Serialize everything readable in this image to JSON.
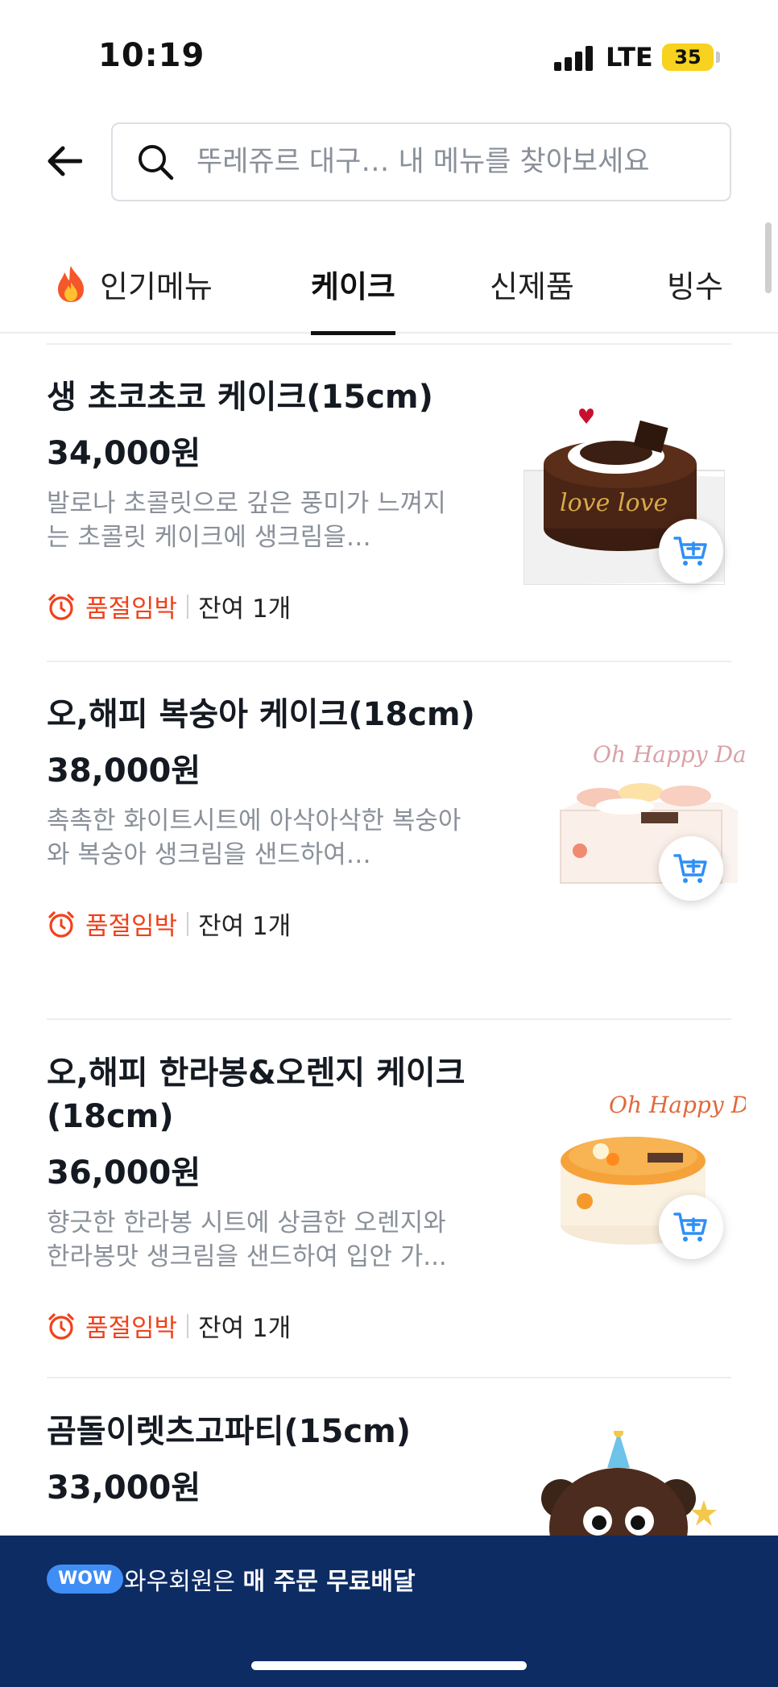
{
  "status_bar": {
    "time": "10:19",
    "network": "LTE",
    "battery": "35"
  },
  "search": {
    "placeholder": "뚜레쥬르 대구… 내 메뉴를 찾아보세요"
  },
  "tabs": [
    {
      "label": "인기메뉴",
      "active": false,
      "icon": "fire-icon"
    },
    {
      "label": "케이크",
      "active": true
    },
    {
      "label": "신제품",
      "active": false
    },
    {
      "label": "빙수",
      "active": false
    }
  ],
  "items": [
    {
      "name": "생 초코초코 케이크(15cm)",
      "price": "34,000원",
      "description": "발로나 초콜릿으로 깊은 풍미가 느껴지는 초콜릿 케이크에 생크림을…",
      "badge": "품절임박",
      "stock": "잔여 1개",
      "image_text": "love love"
    },
    {
      "name": "오,해피 복숭아 케이크(18cm)",
      "price": "38,000원",
      "description": "촉촉한 화이트시트에 아삭아삭한 복숭아와 복숭아 생크림을 샌드하여…",
      "badge": "품절임박",
      "stock": "잔여 1개",
      "image_text": "Oh Happy Day"
    },
    {
      "name": "오,해피 한라봉&오렌지 케이크(18cm)",
      "price": "36,000원",
      "description": "향긋한 한라봉 시트에 상큼한 오렌지와 한라봉맛 생크림을 샌드하여 입안 가...",
      "badge": "품절임박",
      "stock": "잔여 1개",
      "image_text": "Oh Happy Day"
    },
    {
      "name": "곰돌이렛츠고파티(15cm)",
      "price": "33,000원"
    }
  ],
  "banner": {
    "badge": "WOW",
    "text_prefix": "와우회원은 ",
    "text_bold": "매 주문 무료배달"
  },
  "colors": {
    "accent_red": "#f0421c",
    "banner_bg": "#0d2c64",
    "cart_blue": "#2f8ff5"
  }
}
